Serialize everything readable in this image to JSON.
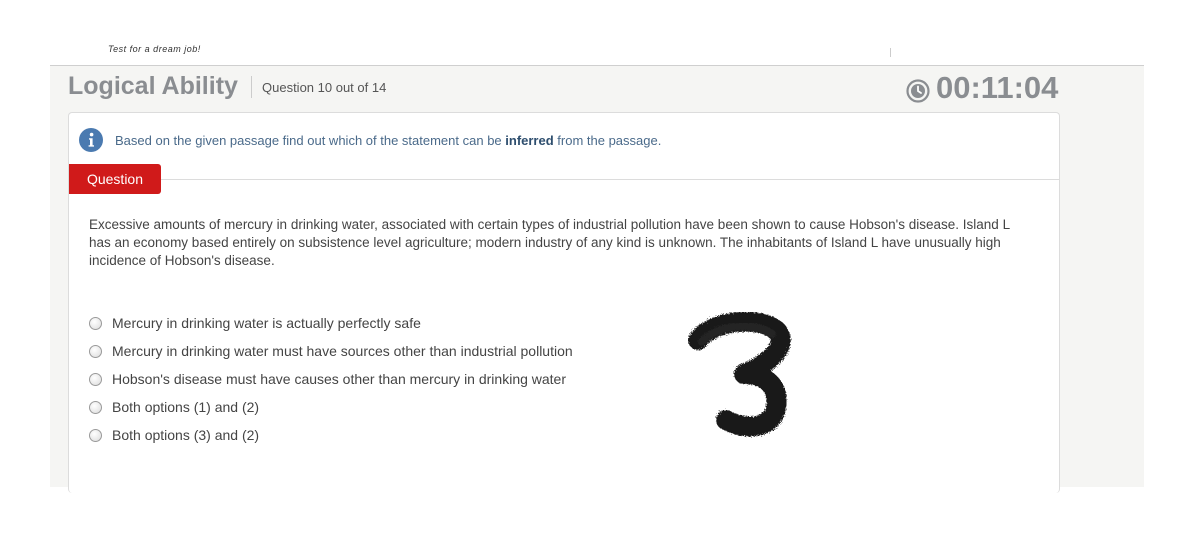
{
  "header": {
    "tagline": "Test for a dream job!"
  },
  "test": {
    "section_title": "Logical Ability",
    "question_counter": "Question 10 out of 14",
    "timer": "00:11:04"
  },
  "instruction": {
    "prefix": "Based on the given passage find out which of the statement can be ",
    "emphasis": "inferred",
    "suffix": " from the passage."
  },
  "question_tab_label": "Question",
  "passage": "Excessive amounts of mercury in drinking water, associated with certain types of industrial pollution have been shown to cause Hobson's disease. Island L has an economy based entirely on subsistence level agriculture; modern industry of any kind is unknown. The inhabitants of Island L have unusually high incidence of Hobson's disease.",
  "options": [
    {
      "label": "Mercury in drinking water is actually perfectly safe"
    },
    {
      "label": "Mercury in drinking water must have sources other than industrial pollution"
    },
    {
      "label": "Hobson's disease must have causes other than mercury in drinking water"
    },
    {
      "label": "Both options (1) and (2)"
    },
    {
      "label": "Both options (3) and (2)"
    }
  ],
  "icons": {
    "info": "info-icon",
    "clock": "clock-icon"
  },
  "colors": {
    "accent_red": "#d01a1a",
    "title_gray": "#8a8d91",
    "info_blue": "#4a7ab0"
  },
  "annotation_mark": "3"
}
